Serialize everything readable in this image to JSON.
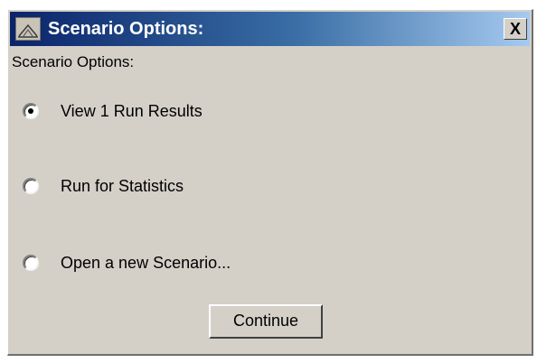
{
  "window": {
    "title": "Scenario Options:",
    "close_label": "X",
    "app_icon": "java-cup-icon"
  },
  "dialog": {
    "header": "Scenario Options:"
  },
  "options": [
    {
      "label": "View 1 Run Results",
      "selected": true
    },
    {
      "label": "Run for Statistics",
      "selected": false
    },
    {
      "label": "Open a new Scenario...",
      "selected": false
    }
  ],
  "buttons": {
    "continue_label": "Continue"
  },
  "colors": {
    "titlebar_start": "#0a246a",
    "titlebar_end": "#a6caf0",
    "window_bg": "#d4d0c8"
  }
}
